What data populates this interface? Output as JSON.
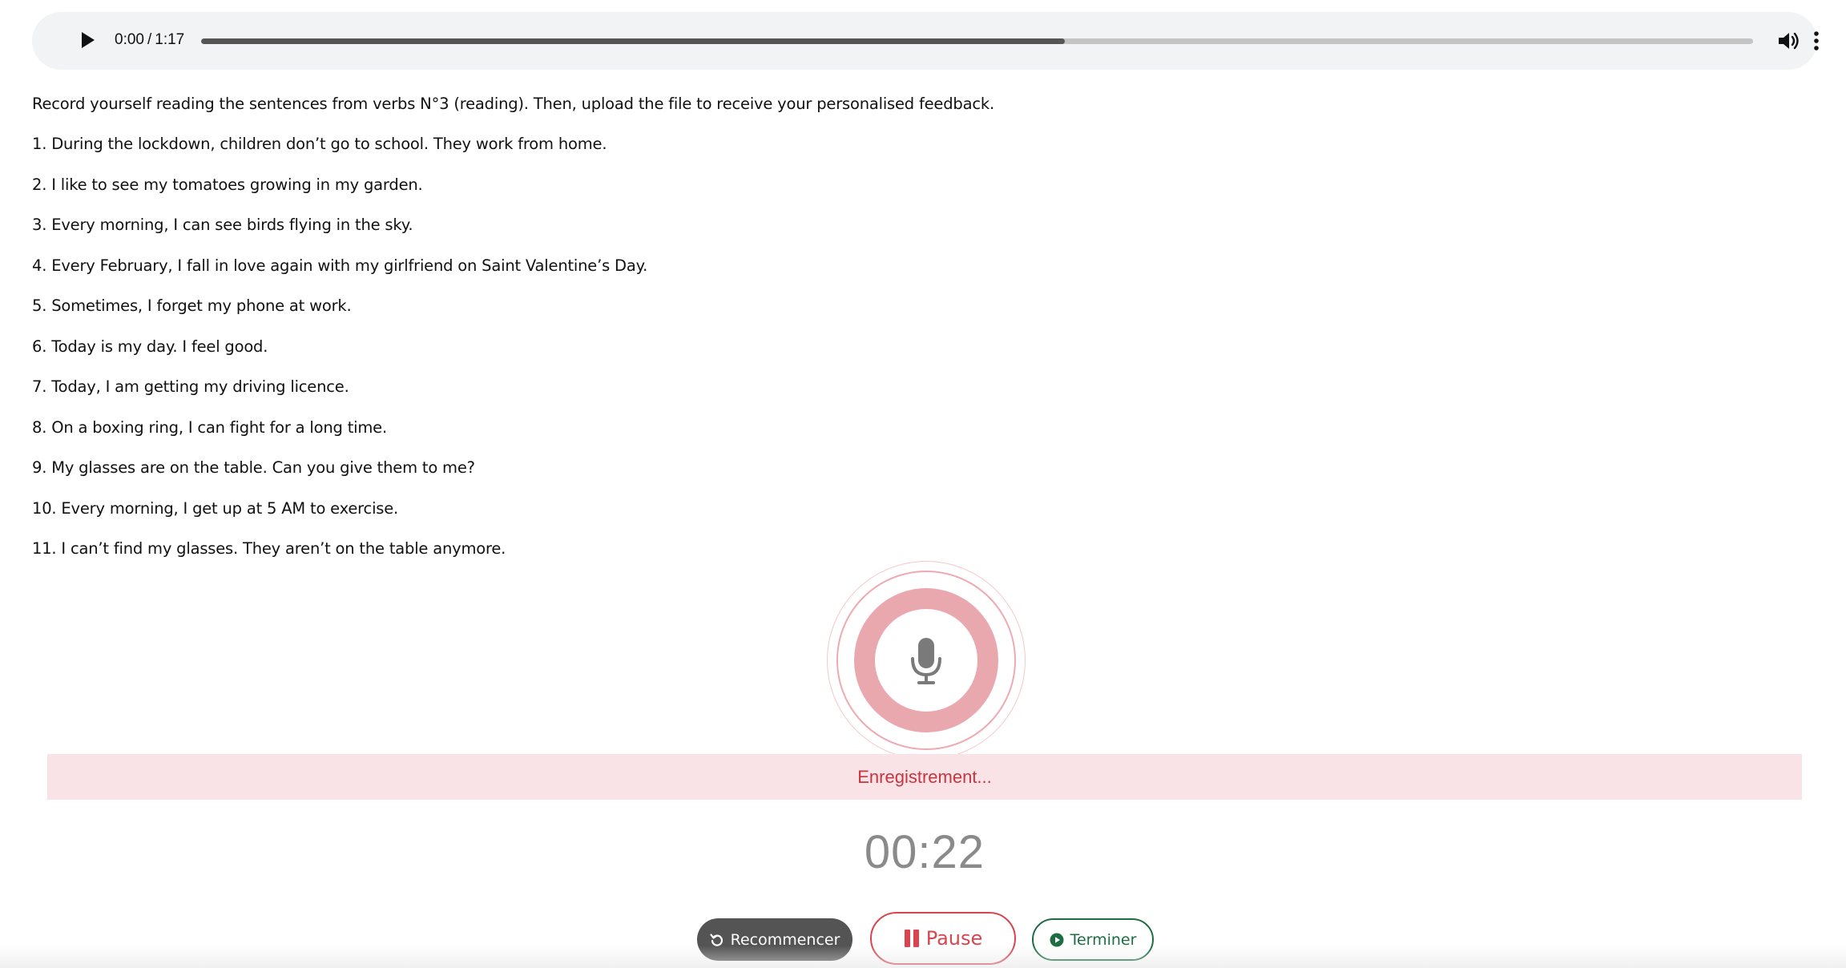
{
  "audio_player": {
    "current_time": "0:00",
    "separator": "/",
    "duration": "1:17",
    "buffered_fraction": 0.5566,
    "icons": {
      "play": "play-icon",
      "volume": "volume-icon",
      "more": "more-vertical-icon"
    }
  },
  "instruction": "Record yourself reading the sentences from verbs N°3 (reading). Then, upload the file to receive your personalised feedback.",
  "sentences": [
    "1. During the lockdown, children don’t go to school. They work from home.",
    "2. I like to see my tomatoes growing in my garden.",
    "3. Every morning, I can see birds flying in the sky.",
    "4. Every February, I fall in love again with my girlfriend on Saint Valentine’s Day.",
    "5. Sometimes, I forget my phone at work.",
    "6. Today is my day. I feel good.",
    "7. Today, I am getting my driving licence.",
    "8. On a boxing ring, I can fight for a long time.",
    "9. My glasses are on the table. Can you give them to me?",
    "10. Every morning, I get up at 5 AM to exercise.",
    "11. I can’t find my glasses. They aren’t on the table anymore."
  ],
  "recorder": {
    "status": "Enregistrement...",
    "timer": "00:22",
    "buttons": {
      "restart": "Recommencer",
      "pause": "Pause",
      "finish": "Terminer"
    },
    "icons": {
      "mic": "microphone-icon",
      "restart": "refresh-icon",
      "pause": "pause-icon",
      "finish": "play-circle-icon"
    },
    "colors": {
      "recording_red": "#d9444f",
      "ring_pink": "#e9a7ae",
      "status_bg": "#f9e3e6",
      "finish_green": "#1d6d43",
      "restart_bg": "#545454"
    }
  }
}
